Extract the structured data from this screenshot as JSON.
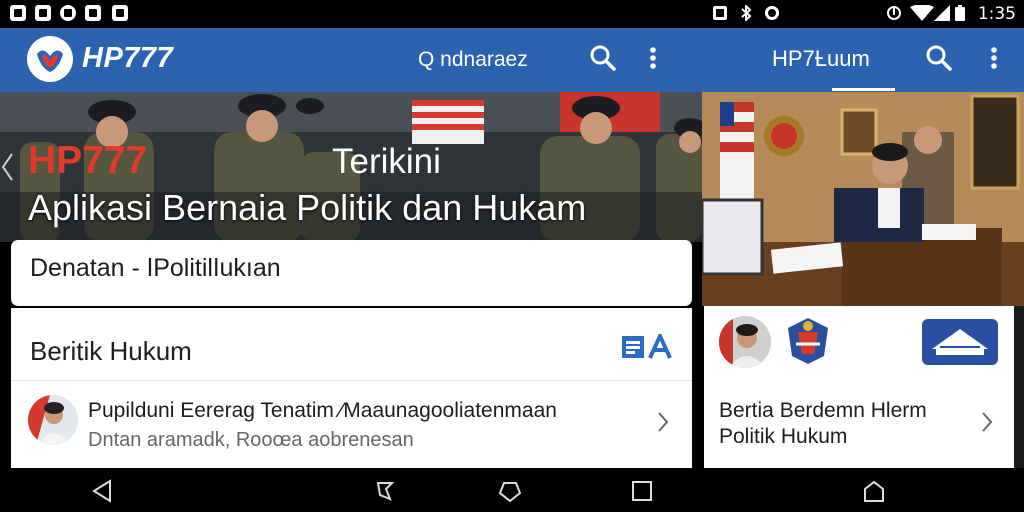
{
  "status_bar": {
    "time": "1:35",
    "left_icons": [
      "notification-icon",
      "image-icon",
      "message-icon",
      "shield-icon",
      "square-icon"
    ],
    "right_icons": [
      "cast-icon",
      "bluetooth-icon",
      "alarm-icon",
      "signal-icon",
      "wifi-icon",
      "battery-icon"
    ]
  },
  "app_bar": {
    "brand": "HP777",
    "search_text": "Q ndnaraez",
    "right_title": "HP7Ƚuum"
  },
  "hero": {
    "title_red": "HP777",
    "title_white": "Terikini",
    "subtitle": "Aplikasi Bernaia Politik dan Hukam"
  },
  "card_top": {
    "text": "Denatan - ǀPolitilǀukıan"
  },
  "section": {
    "title": "Beritik Hukum",
    "item": {
      "title": "Pupilduni Eererag Tenatim ⁄Maaunagooliatenmaan",
      "subtitle": "Dntan aramadk, Rooœa aobrenesan"
    }
  },
  "right_card": {
    "title": "Bertia Berdemn Hlerm Politik Hukum"
  },
  "colors": {
    "app_bar": "#2c63b0",
    "hero_red": "#e23a2e",
    "icon_blue": "#2b6cc4"
  }
}
